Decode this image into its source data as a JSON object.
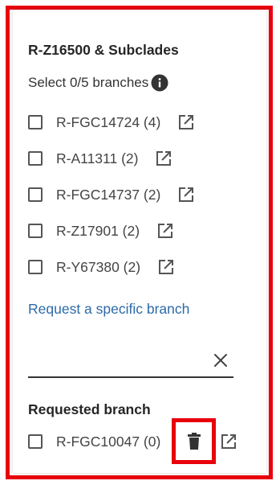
{
  "panel": {
    "title": "R-Z16500 & Subclades",
    "select_text": "Select 0/5 branches",
    "info_icon": "info-icon"
  },
  "branches": [
    {
      "label": "R-FGC14724 (4)",
      "checked": false
    },
    {
      "label": "R-A11311 (2)",
      "checked": false
    },
    {
      "label": "R-FGC14737 (2)",
      "checked": false
    },
    {
      "label": "R-Z17901 (2)",
      "checked": false
    },
    {
      "label": "R-Y67380 (2)",
      "checked": false
    }
  ],
  "request": {
    "link_text": "Request a specific branch",
    "input_value": "",
    "input_placeholder": "",
    "clear_icon": "close-icon"
  },
  "requested": {
    "heading": "Requested branch",
    "label": "R-FGC10047 (0)",
    "delete_icon": "trash-icon",
    "link_icon": "open-in-new-icon"
  },
  "colors": {
    "highlight_red": "#e8000d",
    "link_blue": "#2c6aa8",
    "text_dark": "#262626"
  }
}
